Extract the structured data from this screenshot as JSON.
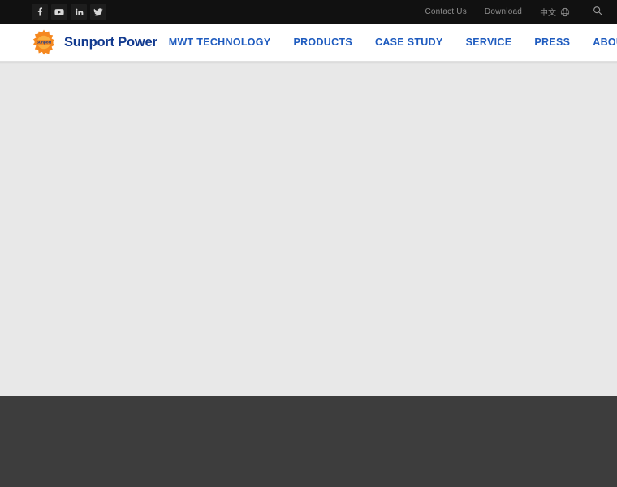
{
  "site": {
    "brand_name": "Sunport Power",
    "logo_mark_text": "Sunport",
    "accent_blue": "#1e5bbf",
    "brand_navy": "#123a8f",
    "logo_orange": "#F5881F",
    "topbar_bg": "#111111",
    "content_bg": "#e8e8e8",
    "footer_bg": "#3d3d3d"
  },
  "topbar": {
    "social": [
      {
        "name": "facebook",
        "label": "Facebook"
      },
      {
        "name": "youtube",
        "label": "YouTube"
      },
      {
        "name": "linkedin",
        "label": "LinkedIn"
      },
      {
        "name": "twitter",
        "label": "Twitter"
      }
    ],
    "links": [
      {
        "label": "Contact Us"
      },
      {
        "label": "Download"
      }
    ],
    "language": {
      "label": "中文",
      "icon": "globe-icon"
    },
    "search": {
      "icon": "search-icon",
      "label": "Search"
    }
  },
  "nav": {
    "items": [
      {
        "label": "MWT TECHNOLOGY"
      },
      {
        "label": "PRODUCTS"
      },
      {
        "label": "CASE STUDY"
      },
      {
        "label": "SERVICE"
      },
      {
        "label": "PRESS"
      },
      {
        "label": "ABOUT US"
      }
    ]
  },
  "content": {
    "body_text": ""
  },
  "footer": {
    "body_text": ""
  }
}
